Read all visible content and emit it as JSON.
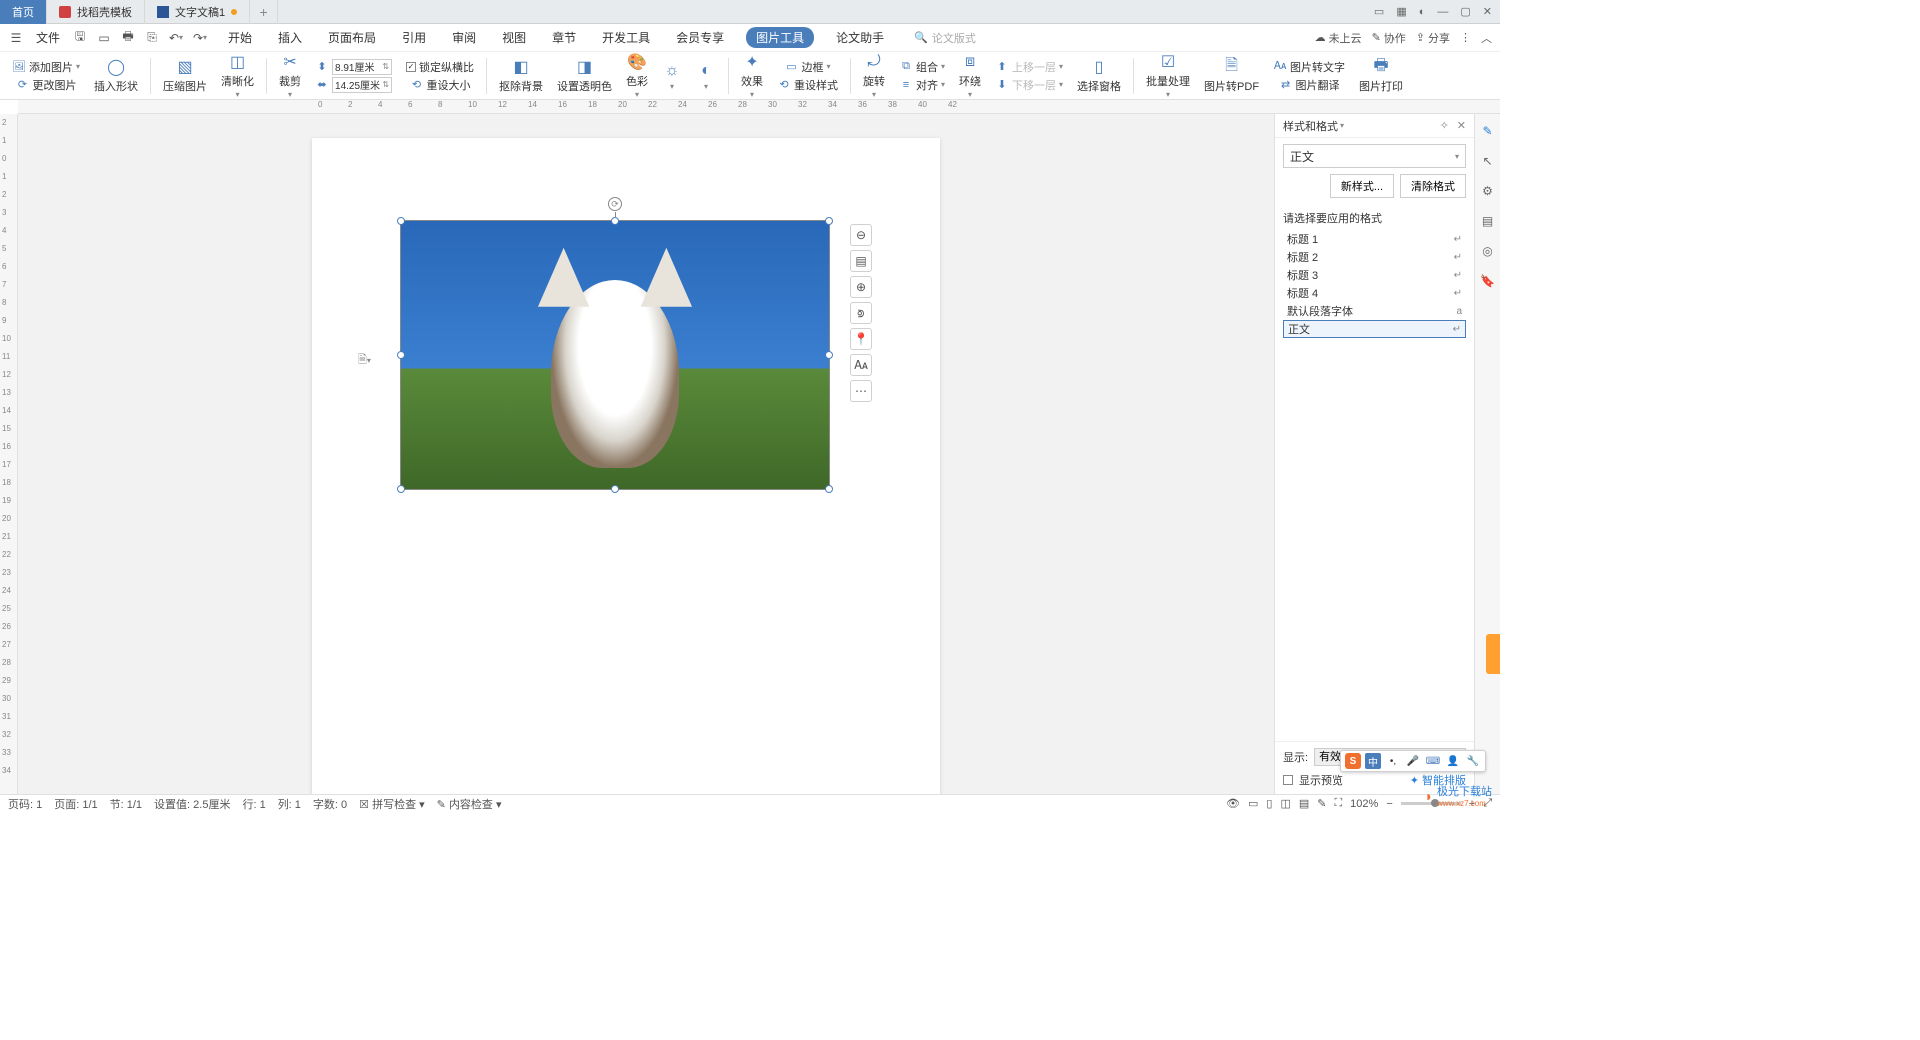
{
  "tabs": {
    "home": "首页",
    "templates": "找稻壳模板",
    "doc": "文字文稿1"
  },
  "menubar": {
    "file": "文件",
    "items": [
      "开始",
      "插入",
      "页面布局",
      "引用",
      "审阅",
      "视图",
      "章节",
      "开发工具",
      "会员专享",
      "图片工具",
      "论文助手"
    ],
    "active_index": 9,
    "search_placeholder": "论文版式"
  },
  "cloud": {
    "not_uploaded": "未上云",
    "collab": "协作",
    "share": "分享"
  },
  "ribbon": {
    "add_image": "添加图片",
    "change_image": "更改图片",
    "insert_shape": "插入形状",
    "compress": "压缩图片",
    "sharpen": "清晰化",
    "crop": "裁剪",
    "width_label": "8.91厘米",
    "height_label": "14.25厘米",
    "lock_ratio": "锁定纵横比",
    "reset_size": "重设大小",
    "remove_bg": "抠除背景",
    "set_transparent": "设置透明色",
    "color": "色彩",
    "effect": "效果",
    "border": "边框",
    "reset_style": "重设样式",
    "rotate": "旋转",
    "group": "组合",
    "align": "对齐",
    "wrap": "环绕",
    "move_up": "上移一层",
    "move_down": "下移一层",
    "select_pane": "选择窗格",
    "batch": "批量处理",
    "to_pdf": "图片转PDF",
    "to_text": "图片转文字",
    "translate": "图片翻译",
    "print": "图片打印"
  },
  "panel": {
    "title": "样式和格式",
    "current": "正文",
    "new_style": "新样式...",
    "clear": "清除格式",
    "choose_label": "请选择要应用的格式",
    "items": [
      "标题 1",
      "标题 2",
      "标题 3",
      "标题 4",
      "默认段落字体",
      "正文"
    ],
    "selected_index": 5,
    "show_label": "显示:",
    "show_value": "有效样式",
    "preview": "显示预览",
    "smart": "智能排版"
  },
  "status": {
    "page_num": "页码: 1",
    "page_of": "页面: 1/1",
    "section": "节: 1/1",
    "pos": "设置值: 2.5厘米",
    "row": "行: 1",
    "col": "列: 1",
    "chars": "字数: 0",
    "spell": "拼写检查",
    "content": "内容检查",
    "zoom": "102%"
  },
  "watermark": {
    "main": "极光下载站",
    "sub": "www.xz7.com"
  }
}
